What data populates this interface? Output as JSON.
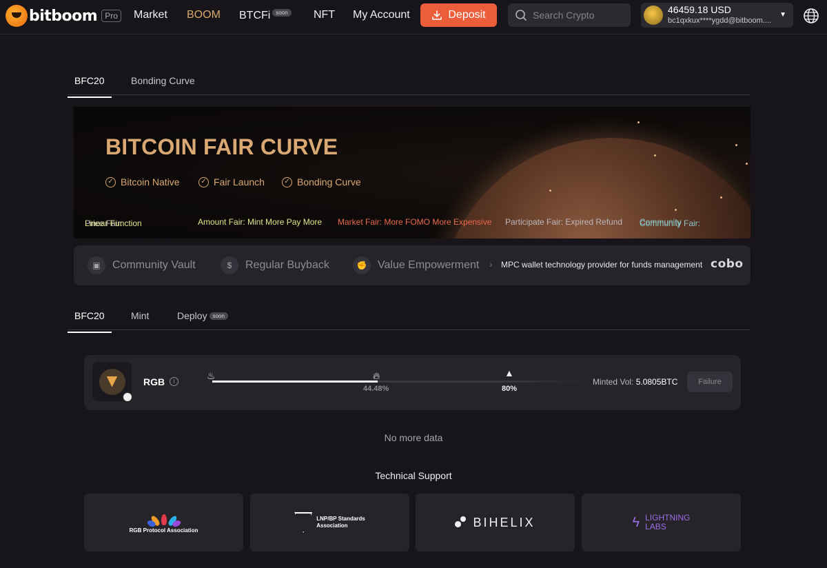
{
  "header": {
    "logo_text": "bitboom",
    "pro_badge": "Pro",
    "nav": [
      {
        "label": "Market"
      },
      {
        "label": "BOOM"
      },
      {
        "label": "BTCFi",
        "badge": "soon"
      },
      {
        "label": "NFT"
      },
      {
        "label": "My Account"
      }
    ],
    "deposit_label": "Deposit",
    "search_placeholder": "Search Crypto",
    "account": {
      "balance": "46459.18 USD",
      "address": "bc1qxkux****ygdd@bitboom...."
    }
  },
  "top_tabs": [
    {
      "label": "BFC20"
    },
    {
      "label": "Bonding Curve"
    }
  ],
  "banner": {
    "title": "BITCOIN FAIR CURVE",
    "features": [
      "Bitcoin Native",
      "Fair Launch",
      "Bonding Curve"
    ],
    "ticker": [
      {
        "label": "Price Fair: ",
        "value": "Linear Function"
      },
      {
        "label": "",
        "value": "Amount Fair: Mint More Pay More"
      },
      {
        "label": "",
        "value": "Market Fair: More FOMO More Expensive"
      },
      {
        "label": "",
        "value": "Participate Fair: Expired Refund"
      },
      {
        "label": "Community Fair: ",
        "value": "Community"
      }
    ]
  },
  "infobar": {
    "items": [
      "Community Vault",
      "Regular Buyback",
      "Value Empowerment"
    ],
    "mpc_text": "MPC wallet technology provider for funds management",
    "partner_logo": "cobo"
  },
  "sub_tabs": [
    {
      "label": "BFC20"
    },
    {
      "label": "Mint"
    },
    {
      "label": "Deploy",
      "badge": "soon"
    }
  ],
  "token": {
    "name": "RGB",
    "progress": 0.4448,
    "progress_label": "44.48%",
    "milestone_label": "80%",
    "minted_label": "Minted Vol: ",
    "minted_value": "5.0805BTC",
    "status_button": "Failure"
  },
  "list_end_text": "No more data",
  "tech_support": {
    "title": "Technical Support",
    "partners": [
      {
        "name": "RGB Protocol Association"
      },
      {
        "name_line1": "LNP/BP Standards",
        "name_line2": "Association"
      },
      {
        "name": "BIHELIX"
      },
      {
        "name_line1": "LIGHTNING",
        "name_line2": "LABS"
      }
    ]
  },
  "colors": {
    "accent": "#ec5e3b",
    "gold": "#d9a873",
    "background": "#17151a",
    "card": "#262429"
  }
}
